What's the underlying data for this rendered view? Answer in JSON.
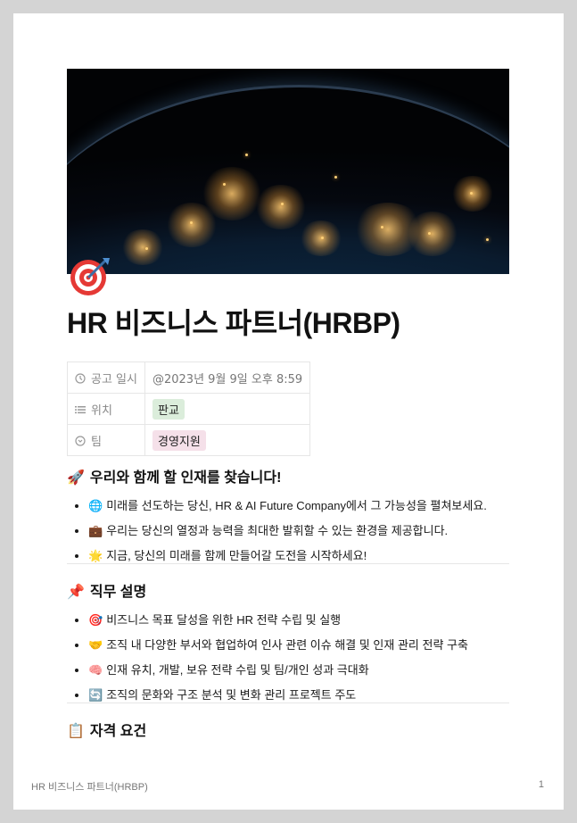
{
  "page": {
    "title": "HR 비즈니스 파트너(HRBP)",
    "icon": "dart-target-icon"
  },
  "properties": [
    {
      "icon": "clock-icon",
      "key": "공고 일시",
      "value": "@2023년 9월 9일 오후 8:59"
    },
    {
      "icon": "list-icon",
      "key": "위치",
      "value": "판교",
      "tag_color": "#dbeddb"
    },
    {
      "icon": "target-circle-icon",
      "key": "팀",
      "value": "경영지원",
      "tag_color": "#f5e0e9"
    }
  ],
  "sections": [
    {
      "emoji": "🚀",
      "heading": "우리와 함께 할 인재를 찾습니다!",
      "items": [
        {
          "emoji": "🌐",
          "text": "미래를 선도하는 당신, HR & AI Future Company에서 그 가능성을 펼쳐보세요."
        },
        {
          "emoji": "💼",
          "text": "우리는 당신의 열정과 능력을 최대한 발휘할 수 있는 환경을 제공합니다."
        },
        {
          "emoji": "🌟",
          "text": "지금, 당신의 미래를 함께 만들어갈 도전을 시작하세요!"
        }
      ]
    },
    {
      "emoji": "📌",
      "heading": "직무 설명",
      "items": [
        {
          "emoji": "🎯",
          "text": "비즈니스 목표 달성을 위한 HR 전략 수립 및 실행"
        },
        {
          "emoji": "🤝",
          "text": "조직 내 다양한 부서와 협업하여 인사 관련 이슈 해결 및 인재 관리 전략 구축"
        },
        {
          "emoji": "🧠",
          "text": "인재 유치, 개발, 보유 전략 수립 및 팀/개인 성과 극대화"
        },
        {
          "emoji": "🔄",
          "text": "조직의 문화와 구조 분석 및 변화 관리 프로젝트 주도"
        }
      ]
    },
    {
      "emoji": "📋",
      "heading": "자격 요건",
      "items": []
    }
  ],
  "footer": {
    "left": "HR 비즈니스 파트너(HRBP)",
    "page_number": "1"
  }
}
